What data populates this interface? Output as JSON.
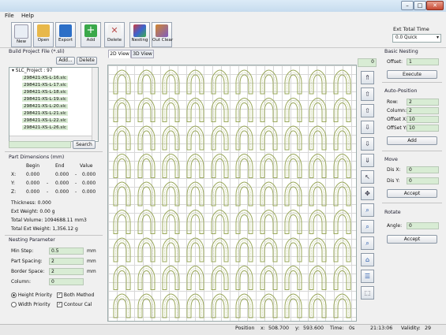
{
  "menu": {
    "file": "File",
    "help": "Help"
  },
  "toolbar": {
    "new": "New",
    "open": "Open",
    "export": "Export",
    "add": "Add",
    "delete": "Delete",
    "nesting": "Nesting",
    "outclear": "Out Clear"
  },
  "toolbar_colors": {
    "new": "#e9eef5",
    "open": "#e8b84a",
    "export": "#2c6fc7",
    "add": "#3aa84a",
    "delete": "#b94c4c",
    "nesting": "#7e5dc0",
    "outclear": "#d1862e"
  },
  "ext_time": {
    "label": "Ext Total Time",
    "value": "0.0 Quick"
  },
  "build": {
    "title": "Build Project File (*.sli)",
    "add_btn": "Add...",
    "delete_btn": "Delete",
    "tree_root": "SLC_Project : 97",
    "files": [
      "298421-XS-L-16.slc",
      "298421-XS-L-17.slc",
      "298421-XS-L-18.slc",
      "298421-XS-L-19.slc",
      "298421-XS-L-20.slc",
      "298421-XS-L-21.slc",
      "298421-XS-L-22.slc",
      "298421-XS-L-26.slc"
    ],
    "search_btn": "Search"
  },
  "part_dims": {
    "title": "Part Dimensions (mm)",
    "headers": [
      "Begin",
      "End",
      "Value"
    ],
    "rows": [
      {
        "axis": "X:",
        "begin": "0.000",
        "end": "0.000",
        "value": "0.000"
      },
      {
        "axis": "Y:",
        "begin": "0.000",
        "end": "0.000",
        "value": "0.000"
      },
      {
        "axis": "Z:",
        "begin": "0.000",
        "end": "0.000",
        "value": "0.000"
      }
    ],
    "dash": "-",
    "thickness": "Thickness:  0.000",
    "ext_weight": "Ext Weight:  0.00 g",
    "total_volume": "Total Volume:  1094688.11 mm3",
    "total_ext_weight": "Total Ext Weight:  1,356.12 g"
  },
  "nesting": {
    "title": "Nesting Parameter",
    "min_step_label": "Min Step:",
    "min_step": "0.5",
    "part_spacing_label": "Part Spacing:",
    "part_spacing": "2",
    "border_space_label": "Border Space:",
    "border_space": "2",
    "column_label": "Column:",
    "column": "0",
    "unit": "mm",
    "height_priority": "Height Priority",
    "width_priority": "Width Priority",
    "both_method": "Both Method",
    "contour_cal": "Contour Cal"
  },
  "view": {
    "tab2d": "2D View",
    "tab3d": "3D View",
    "counter": "0"
  },
  "tray": {
    "rows": 9,
    "cols": 10
  },
  "basic_nesting": {
    "title": "Basic Nesting",
    "offset_label": "Offset:",
    "offset": "1",
    "execute": "Execute"
  },
  "auto_position": {
    "title": "Auto-Position",
    "row_label": "Row:",
    "row": "2",
    "column_label": "Column:",
    "column": "2",
    "offsetx_label": "Offset X:",
    "offsetx": "10",
    "offsety_label": "OffSet Y:",
    "offsety": "10",
    "add": "Add"
  },
  "move": {
    "title": "Move",
    "disx_label": "Dis X:",
    "disx": "0",
    "disy_label": "Dis Y:",
    "disy": "0",
    "accept": "Accept"
  },
  "rotate": {
    "title": "Rotate",
    "angle_label": "Angle:",
    "angle": "0",
    "accept": "Accept"
  },
  "status": {
    "position": "Position",
    "x_label": "x:",
    "x": "508.700",
    "y_label": "y:",
    "y": "593.600",
    "time_label": "Time:",
    "time": "0s",
    "clock": "21:13:06",
    "validity_label": "Validity:",
    "validity": "29"
  }
}
